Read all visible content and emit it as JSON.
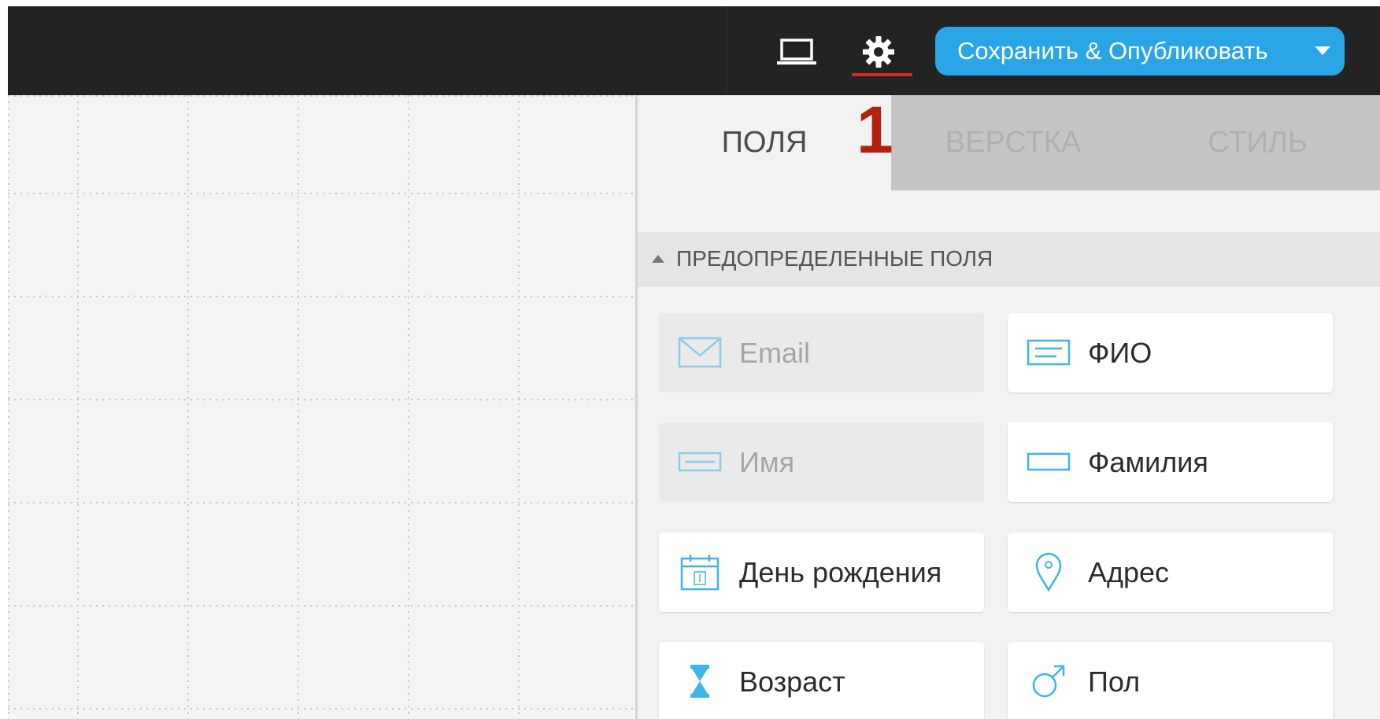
{
  "toolbar": {
    "preview_icon": "laptop-icon",
    "settings_icon": "gear-icon",
    "save_label": "Сохранить & Опубликовать",
    "accent_color": "#2aa5e6",
    "underline_color": "#cc2f1c"
  },
  "annotation": {
    "marker": "1"
  },
  "tabs": [
    {
      "label": "ПОЛЯ",
      "active": true
    },
    {
      "label": "ВЕРСТКА",
      "active": false
    },
    {
      "label": "СТИЛЬ",
      "active": false
    }
  ],
  "section": {
    "title": "ПРЕДОПРЕДЕЛЕННЫЕ ПОЛЯ",
    "expanded": true
  },
  "fields": [
    {
      "label": "Email",
      "icon": "envelope-icon",
      "disabled": true
    },
    {
      "label": "ФИО",
      "icon": "text-lines-icon",
      "disabled": false
    },
    {
      "label": "Имя",
      "icon": "single-line-input-icon",
      "disabled": true
    },
    {
      "label": "Фамилия",
      "icon": "input-box-icon",
      "disabled": false
    },
    {
      "label": "День рождения",
      "icon": "calendar-icon",
      "disabled": false
    },
    {
      "label": "Адрес",
      "icon": "map-pin-icon",
      "disabled": false
    },
    {
      "label": "Возраст",
      "icon": "hourglass-icon",
      "disabled": false
    },
    {
      "label": "Пол",
      "icon": "gender-male-icon",
      "disabled": false
    }
  ]
}
